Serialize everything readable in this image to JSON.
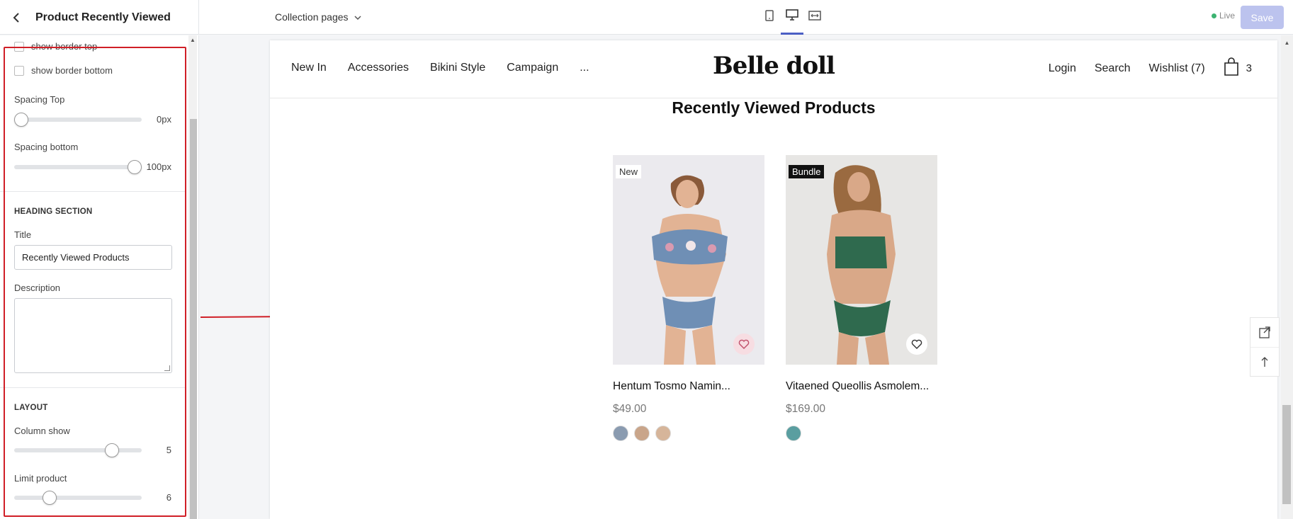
{
  "panel": {
    "title": "Product Recently Viewed",
    "checkboxes": [
      "show border top",
      "show border bottom"
    ],
    "spacing_top": {
      "label": "Spacing Top",
      "value": "0px",
      "fraction": 0.0
    },
    "spacing_bottom": {
      "label": "Spacing bottom",
      "value": "100px",
      "fraction": 1.0
    },
    "heading_section": {
      "title": "HEADING SECTION",
      "title_label": "Title",
      "title_value": "Recently Viewed Products",
      "description_label": "Description",
      "description_value": ""
    },
    "layout": {
      "title": "LAYOUT",
      "column_show": {
        "label": "Column show",
        "value": "5",
        "fraction": 0.8
      },
      "limit_product": {
        "label": "Limit product",
        "value": "6",
        "fraction": 0.25
      }
    }
  },
  "topbar": {
    "page_selector": "Collection pages",
    "live_label": "Live",
    "save_label": "Save",
    "active_device": "desktop"
  },
  "store": {
    "nav_left": [
      "New In",
      "Accessories",
      "Bikini Style",
      "Campaign",
      "..."
    ],
    "logo": "Belle doll",
    "nav_right": {
      "login": "Login",
      "search": "Search",
      "wishlist": "Wishlist (7)",
      "cart_count": "3"
    },
    "section_title": "Recently Viewed Products",
    "products": [
      {
        "badge": "New",
        "name": "Hentum Tosmo Namin...",
        "price": "$49.00",
        "swatches": [
          "#8a9bb0",
          "#c9a58a",
          "#d6b59a"
        ]
      },
      {
        "badge": "Bundle",
        "name": "Vitaened Queollis Asmolem...",
        "price": "$169.00",
        "swatches": [
          "#5a9ea0"
        ]
      }
    ]
  },
  "colors": {
    "accent": "#4b5fc4",
    "highlight": "#d01f27",
    "save_disabled": "#bcc3ee",
    "live": "#3cb371"
  }
}
